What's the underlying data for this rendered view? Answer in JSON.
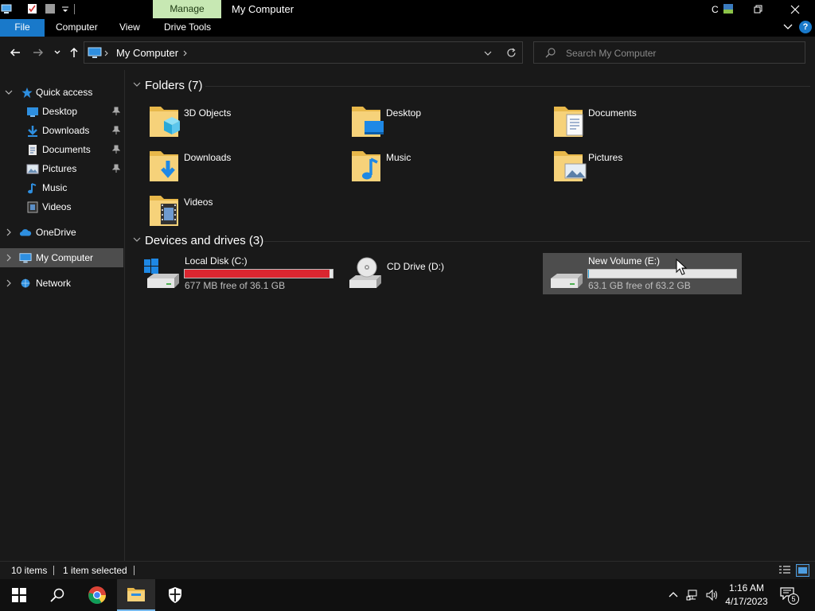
{
  "window": {
    "title": "My Computer",
    "context_tab": "Manage",
    "right_partial": "C",
    "controls": {
      "minimize": "—",
      "maximize": "❐",
      "close": "✕"
    }
  },
  "ribbon": {
    "tabs": [
      "File",
      "Computer",
      "View",
      "Drive Tools"
    ],
    "help": "?"
  },
  "address": {
    "path": "My Computer",
    "search_placeholder": "Search My Computer"
  },
  "nav_pane": {
    "quick_access": "Quick access",
    "quick_items": [
      {
        "label": "Desktop",
        "icon": "desktop-icon",
        "pinned": true
      },
      {
        "label": "Downloads",
        "icon": "downloads-icon",
        "pinned": true
      },
      {
        "label": "Documents",
        "icon": "documents-icon",
        "pinned": true
      },
      {
        "label": "Pictures",
        "icon": "pictures-icon",
        "pinned": true
      },
      {
        "label": "Music",
        "icon": "music-icon",
        "pinned": false
      },
      {
        "label": "Videos",
        "icon": "videos-icon",
        "pinned": false
      }
    ],
    "onedrive": "OneDrive",
    "my_computer": "My Computer",
    "network": "Network"
  },
  "content": {
    "folders_header": "Folders (7)",
    "folders": [
      {
        "name": "3D Objects"
      },
      {
        "name": "Desktop"
      },
      {
        "name": "Documents"
      },
      {
        "name": "Downloads"
      },
      {
        "name": "Music"
      },
      {
        "name": "Pictures"
      },
      {
        "name": "Videos"
      }
    ],
    "drives_header": "Devices and drives (3)",
    "drives": [
      {
        "name": "Local Disk (C:)",
        "free": "677 MB free of 36.1 GB",
        "used_fraction": 0.98,
        "bar_color": "#da2630"
      },
      {
        "name": "CD Drive (D:)"
      },
      {
        "name": "New Volume (E:)",
        "free": "63.1 GB free of 63.2 GB",
        "used_fraction": 0.002,
        "bar_color": "#26a0da"
      }
    ]
  },
  "status": {
    "items": "10 items",
    "selected": "1 item selected"
  },
  "taskbar": {
    "time": "1:16 AM",
    "date": "4/17/2023",
    "notifications": "5"
  },
  "colors": {
    "accent": "#1979ca",
    "manage_tab": "#c7e8b3",
    "low_space": "#da2630"
  }
}
